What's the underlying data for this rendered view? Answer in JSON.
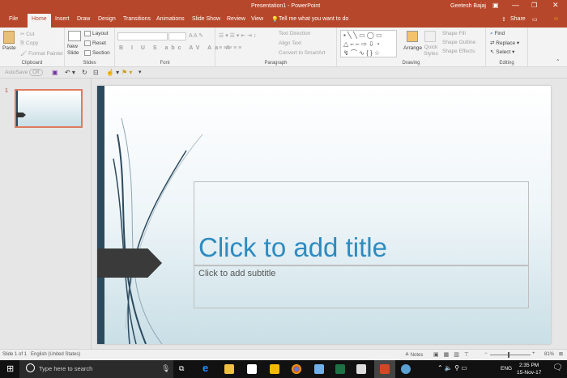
{
  "titlebar": {
    "title": "Presentation1  -  PowerPoint",
    "user": "Geetesh Bajaj"
  },
  "tabs": [
    "File",
    "Home",
    "Insert",
    "Draw",
    "Design",
    "Transitions",
    "Animations",
    "Slide Show",
    "Review",
    "View"
  ],
  "tell_me": "Tell me what you want to do",
  "share": "Share",
  "ribbon": {
    "clipboard": {
      "label": "Clipboard",
      "paste": "Paste",
      "cut": "Cut",
      "copy": "Copy",
      "format_painter": "Format Painter"
    },
    "slides": {
      "label": "Slides",
      "new_slide": "New Slide",
      "layout": "Layout",
      "reset": "Reset",
      "section": "Section"
    },
    "font": {
      "label": "Font"
    },
    "paragraph": {
      "label": "Paragraph",
      "text_direction": "Text Direction",
      "align_text": "Align Text",
      "convert": "Convert to SmartArt"
    },
    "drawing": {
      "label": "Drawing",
      "arrange": "Arrange",
      "quick_styles": "Quick Styles",
      "shape_fill": "Shape Fill",
      "shape_outline": "Shape Outline",
      "shape_effects": "Shape Effects"
    },
    "editing": {
      "label": "Editing",
      "find": "Find",
      "replace": "Replace",
      "select": "Select"
    }
  },
  "qat": {
    "autosave": "AutoSave",
    "autosave_state": "Off"
  },
  "thumbnails": [
    {
      "number": "1"
    }
  ],
  "slide": {
    "title_placeholder": "Click to add title",
    "subtitle_placeholder": "Click to add subtitle",
    "title_color": "#2e8bc0"
  },
  "status": {
    "slide_count": "Slide 1 of 1",
    "language": "English (United States)",
    "notes": "Notes",
    "zoom": "81%"
  },
  "taskbar": {
    "search_placeholder": "Type here to search",
    "time": "2:35 PM",
    "date": "15-Nov-17",
    "lang": "ENG"
  }
}
